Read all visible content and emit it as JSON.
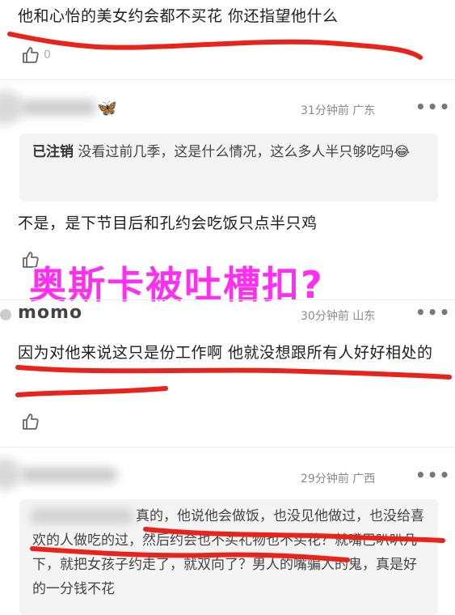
{
  "top_comment": {
    "text": "他和心怡的美女约会都不买花 你还指望他什么",
    "like_count": "0"
  },
  "comment2": {
    "author": "",
    "time": "31分钟前",
    "location": "广东",
    "quote_author": "已注销",
    "quote_text": "没看过前几季，这是什么情况，这么多人半只够吃吗😂",
    "text": "不是，是下节目后和孔约会吃饭只点半只鸡"
  },
  "overlay_title": "奥斯卡被吐槽扣?",
  "comment3": {
    "author": "momo",
    "time": "30分钟前",
    "location": "山东",
    "text": "因为对他来说这只是份工作啊 他就没想跟所有人好好相处的"
  },
  "comment4": {
    "author": "",
    "time": "29分钟前",
    "location": "广西",
    "quote_text": "真的，他说他会做饭，也没见他做过，也没给喜欢的人做吃的过，然后约会也不买礼物也不买花？就嘴巴叭叭几下，就把女孩子约走了，就双向了？男人的嘴骗人的鬼，真是好的一分钱不花"
  },
  "more_icon": "more-dots-icon",
  "like_icon": "thumb-up-icon",
  "colors": {
    "highlight": "#e8231b",
    "overlay": "#ff2ef0"
  }
}
